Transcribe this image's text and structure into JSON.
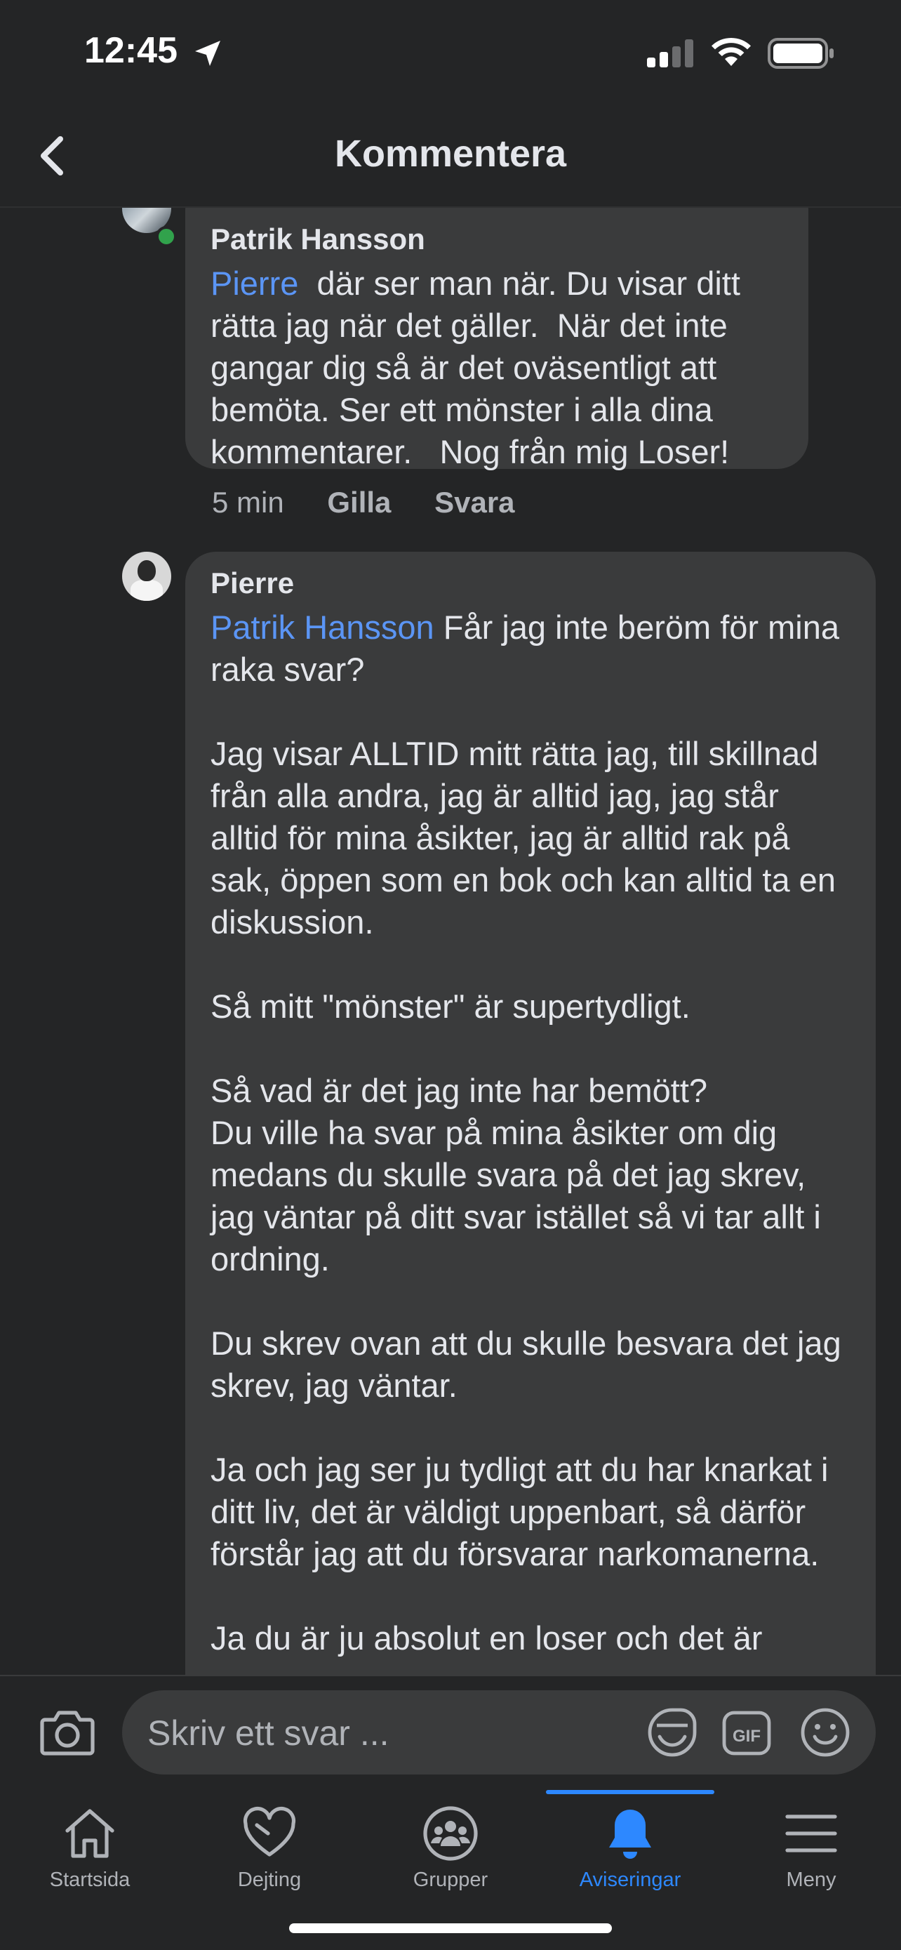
{
  "status_bar": {
    "time": "12:45"
  },
  "header": {
    "title": "Kommentera",
    "back_icon": "chevron-left-icon"
  },
  "comments": [
    {
      "author": "Patrik Hansson",
      "mention": "Pierre",
      "text": "  där ser man när. Du visar ditt rätta jag när det gäller.  När det inte gangar dig så är det oväsentligt att bemöta. Ser ett mönster i alla dina kommentarer.   Nog från mig Loser!",
      "time": "5 min",
      "like_label": "Gilla",
      "reply_label": "Svara",
      "online": true
    },
    {
      "author": "Pierre",
      "mention": "Patrik Hansson",
      "text": " Får jag inte beröm för mina raka svar?\n\nJag visar ALLTID mitt rätta jag, till skillnad från alla andra, jag är alltid jag, jag står alltid för mina åsikter, jag är alltid rak på sak, öppen som en bok och kan alltid ta en diskussion.\n\nSå mitt \"mönster\" är supertydligt.\n\nSå vad är det jag inte har bemött?\nDu ville ha svar på mina åsikter om dig medans du skulle svara på det jag skrev, jag väntar på ditt svar istället så vi tar allt i ordning.\n\nDu skrev ovan att du skulle besvara det jag skrev, jag väntar.\n\nJa och jag ser ju tydligt att du har knarkat i ditt liv, det är väldigt uppenbart, så därför förstår jag att du försvarar narkomanerna.\n\nJa du är ju absolut en loser och det är"
    }
  ],
  "reply_bar": {
    "placeholder": "Skriv ett svar ..."
  },
  "tabs": [
    {
      "label": "Startsida",
      "icon": "home-icon",
      "active": false
    },
    {
      "label": "Dejting",
      "icon": "heart-icon",
      "active": false
    },
    {
      "label": "Grupper",
      "icon": "groups-icon",
      "active": false
    },
    {
      "label": "Aviseringar",
      "icon": "bell-icon",
      "active": true
    },
    {
      "label": "Meny",
      "icon": "menu-icon",
      "active": false
    }
  ],
  "colors": {
    "background": "#242526",
    "bubble": "#3a3b3c",
    "mention": "#5b95f5",
    "active_tab": "#2d88ff",
    "online": "#31a24c"
  }
}
